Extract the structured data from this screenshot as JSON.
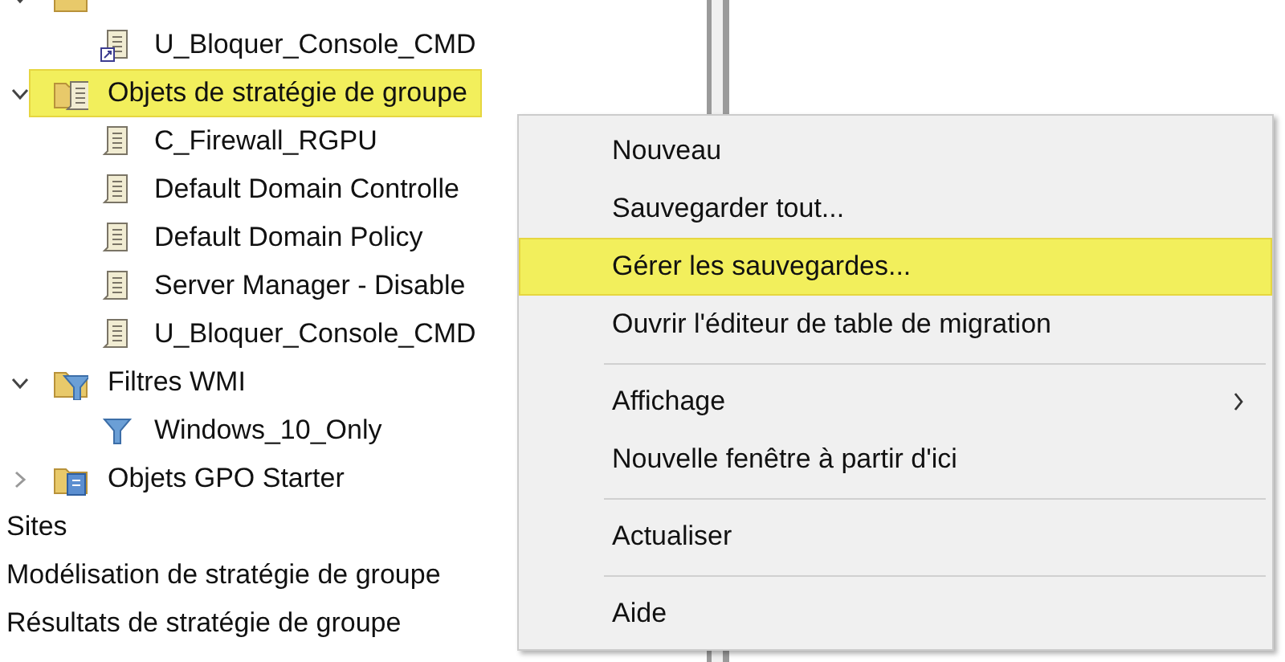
{
  "tree": [
    {
      "children": [
        {
          "kind": "folder",
          "expanded": true,
          "selected": false,
          "children": [
            {
              "label": "U_Bloquer_Console_CMD",
              "kind": "link",
              "selected": false
            }
          ]
        },
        {
          "label": "Objets de stratégie de groupe",
          "kind": "policy-folder",
          "expanded": true,
          "selected": true,
          "children": [
            {
              "label": "C_Firewall_RGPU",
              "kind": "policy",
              "selected": false
            },
            {
              "label": "Default Domain Controlle",
              "kind": "policy",
              "selected": false
            },
            {
              "label": "Default Domain Policy",
              "kind": "policy",
              "selected": false
            },
            {
              "label": "Server Manager - Disable",
              "kind": "policy",
              "selected": false
            },
            {
              "label": "U_Bloquer_Console_CMD",
              "kind": "policy",
              "selected": false
            }
          ]
        },
        {
          "label": "Filtres WMI",
          "kind": "filter-folder",
          "expanded": true,
          "selected": false,
          "children": [
            {
              "label": "Windows_10_Only",
              "kind": "filter",
              "selected": false
            }
          ]
        },
        {
          "label": "Objets GPO Starter",
          "kind": "starter-folder",
          "expanded": false,
          "selected": false
        }
      ]
    },
    {
      "label": "Sites",
      "selected": false
    },
    {
      "label": "Modélisation de stratégie de groupe",
      "selected": false
    },
    {
      "label": "Résultats de stratégie de groupe",
      "selected": false
    }
  ],
  "context_menu": [
    {
      "kind": "item",
      "label": "Nouveau",
      "selected": false,
      "submenu": false
    },
    {
      "kind": "item",
      "label": "Sauvegarder tout...",
      "selected": false,
      "submenu": false
    },
    {
      "kind": "item",
      "label": "Gérer les sauvegardes...",
      "selected": true,
      "submenu": false
    },
    {
      "kind": "item",
      "label": "Ouvrir l'éditeur de table de migration",
      "selected": false,
      "submenu": false
    },
    {
      "kind": "separator"
    },
    {
      "kind": "item",
      "label": "Affichage",
      "selected": false,
      "submenu": true
    },
    {
      "kind": "item",
      "label": "Nouvelle fenêtre à partir d'ici",
      "selected": false,
      "submenu": false
    },
    {
      "kind": "separator"
    },
    {
      "kind": "item",
      "label": "Actualiser",
      "selected": false,
      "submenu": false
    },
    {
      "kind": "separator"
    },
    {
      "kind": "item",
      "label": "Aide",
      "selected": false,
      "submenu": false
    }
  ]
}
